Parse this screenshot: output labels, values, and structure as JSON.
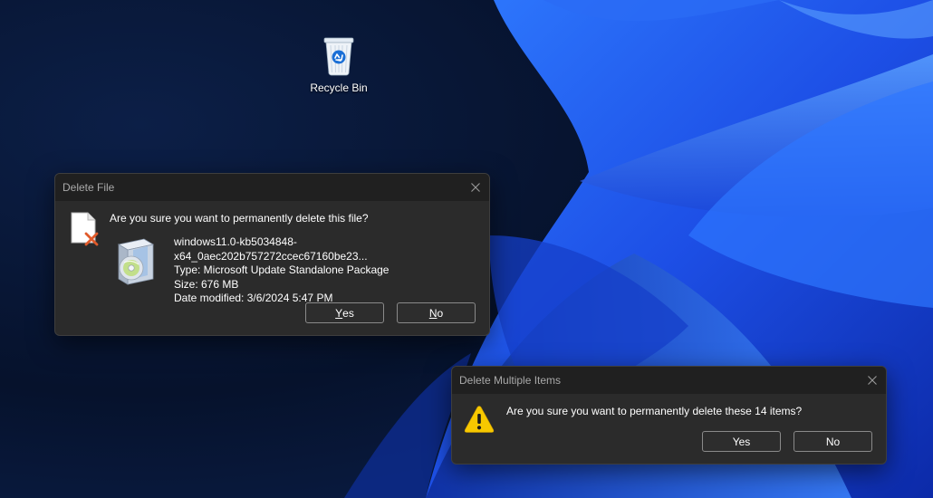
{
  "desktop": {
    "recycle_bin": {
      "label": "Recycle Bin",
      "icon": "recycle-bin-icon"
    }
  },
  "delete_file_dialog": {
    "title": "Delete File",
    "message": "Are you sure you want to permanently delete this file?",
    "file": {
      "name": "windows11.0-kb5034848-x64_0aec202b757272ccec67160be23...",
      "type": "Type: Microsoft Update Standalone Package",
      "size": "Size: 676 MB",
      "date_modified": "Date modified: 3/6/2024 5:47 PM"
    },
    "yes_accel": "Y",
    "yes_rest": "es",
    "no_accel": "N",
    "no_rest": "o"
  },
  "delete_multiple_dialog": {
    "title": "Delete Multiple Items",
    "message": "Are you sure you want to permanently delete these 14 items?",
    "yes_label": "Yes",
    "no_label": "No"
  },
  "colors": {
    "dialog_bg": "#2b2b2b",
    "titlebar_bg": "#202020",
    "wallpaper_blue": "#1f5cff",
    "warning_yellow": "#f7c800"
  }
}
